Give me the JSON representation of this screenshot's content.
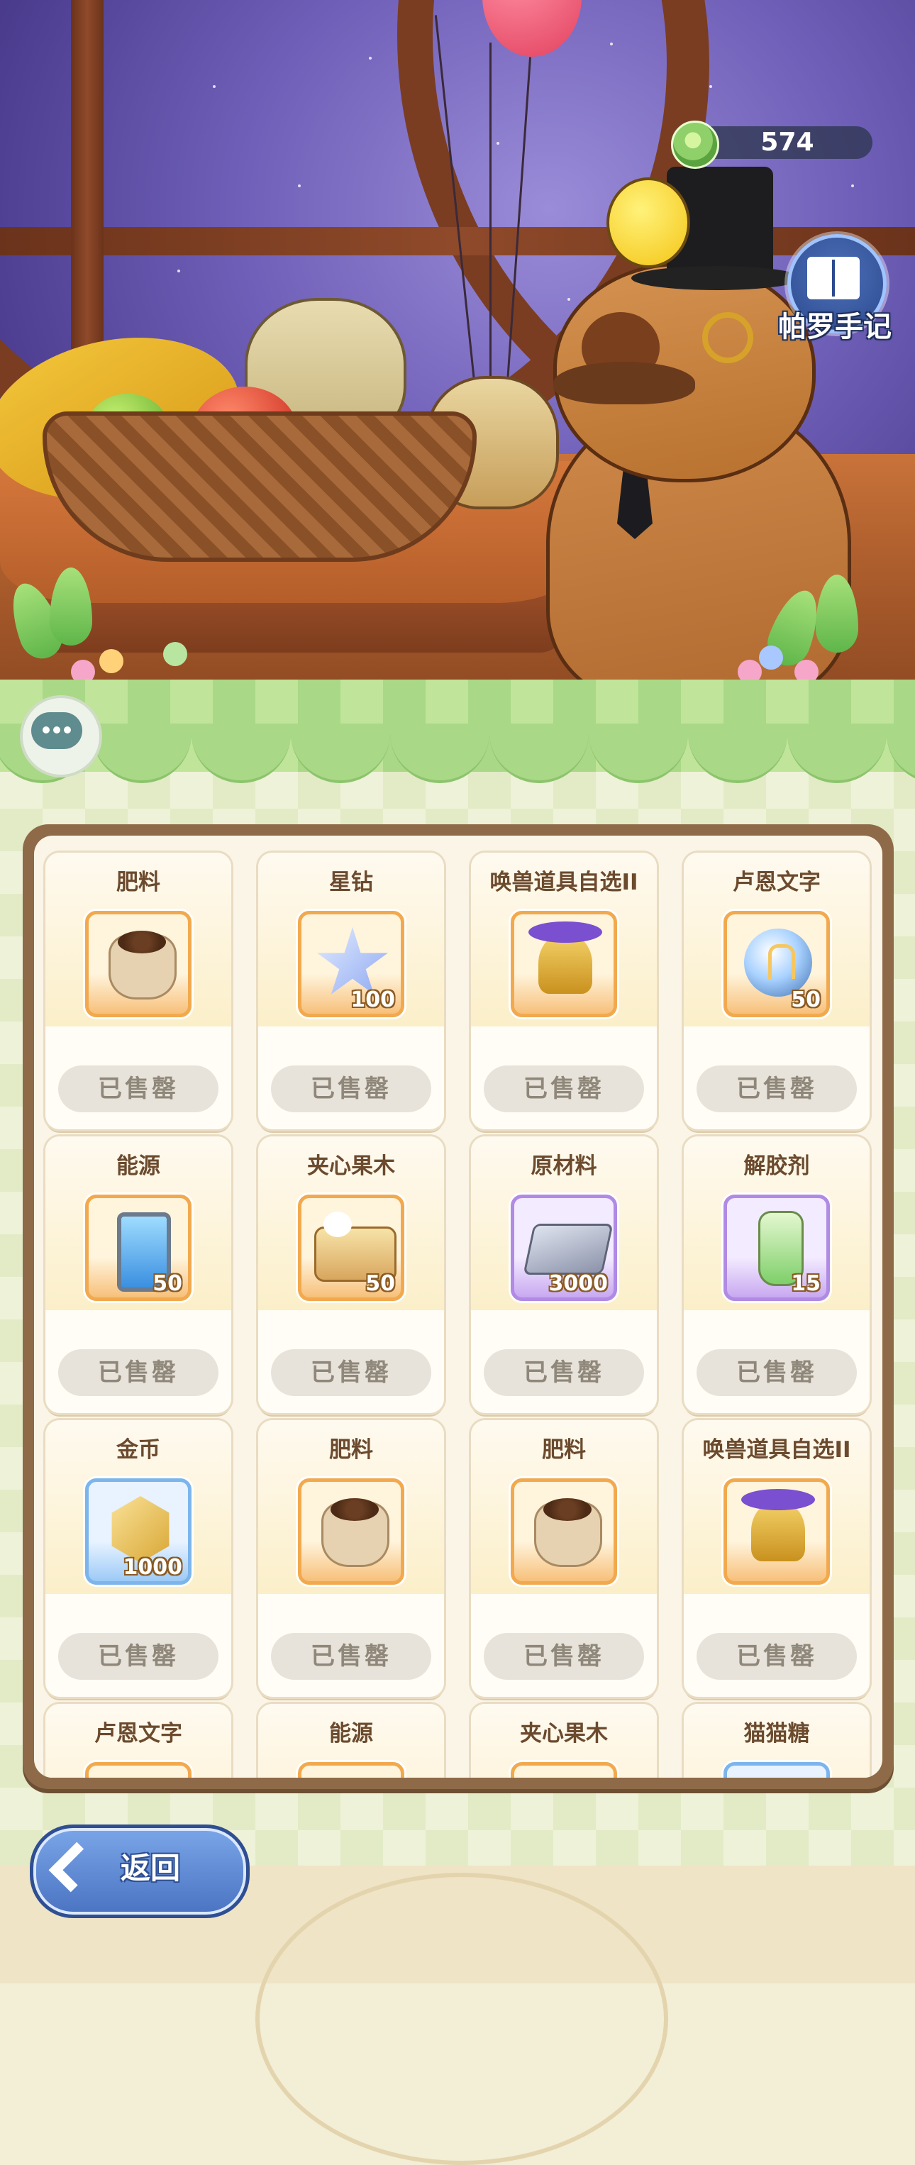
{
  "header": {
    "currency_value": "574",
    "currency_icon": "leaf-coin-icon",
    "handbook_label": "帕罗手记",
    "handbook_icon": "book-quill-icon"
  },
  "chat": {
    "icon": "chat-bubble-icon"
  },
  "shop": {
    "items": [
      {
        "name": "肥料",
        "qty": "",
        "status": "已售罄",
        "icon": "fertilizer-sack-icon",
        "frame": "orange"
      },
      {
        "name": "星钻",
        "qty": "100",
        "status": "已售罄",
        "icon": "star-diamond-icon",
        "frame": "orange"
      },
      {
        "name": "唤兽道具自选II",
        "qty": "",
        "status": "已售罄",
        "icon": "golden-bell-icon",
        "frame": "orange"
      },
      {
        "name": "卢恩文字",
        "qty": "50",
        "status": "已售罄",
        "icon": "rune-orb-icon",
        "frame": "orange"
      },
      {
        "name": "能源",
        "qty": "50",
        "status": "已售罄",
        "icon": "energy-canister-icon",
        "frame": "orange"
      },
      {
        "name": "夹心果木",
        "qty": "50",
        "status": "已售罄",
        "icon": "filled-log-icon",
        "frame": "orange"
      },
      {
        "name": "原材料",
        "qty": "3000",
        "status": "已售罄",
        "icon": "metal-ingot-icon",
        "frame": "purple"
      },
      {
        "name": "解胶剂",
        "qty": "15",
        "status": "已售罄",
        "icon": "solvent-bottle-icon",
        "frame": "purple"
      },
      {
        "name": "金币",
        "qty": "1000",
        "status": "已售罄",
        "icon": "gold-coin-icon",
        "frame": "blue"
      },
      {
        "name": "肥料",
        "qty": "",
        "status": "已售罄",
        "icon": "fertilizer-sack-icon",
        "frame": "orange"
      },
      {
        "name": "肥料",
        "qty": "",
        "status": "已售罄",
        "icon": "fertilizer-sack-icon",
        "frame": "orange"
      },
      {
        "name": "唤兽道具自选II",
        "qty": "",
        "status": "已售罄",
        "icon": "golden-bell-icon",
        "frame": "orange"
      },
      {
        "name": "卢恩文字",
        "qty": "",
        "status": "",
        "icon": "",
        "frame": "orange"
      },
      {
        "name": "能源",
        "qty": "",
        "status": "",
        "icon": "",
        "frame": "orange"
      },
      {
        "name": "夹心果木",
        "qty": "",
        "status": "",
        "icon": "",
        "frame": "orange"
      },
      {
        "name": "猫猫糖",
        "qty": "",
        "status": "",
        "icon": "",
        "frame": "blue"
      }
    ]
  },
  "footer": {
    "back_label": "返回",
    "back_icon": "chevron-left-icon"
  },
  "colors": {
    "sold_out_button": "#e8e3da",
    "item_name": "#6b4a2e",
    "panel_border": "#8e6a48"
  }
}
